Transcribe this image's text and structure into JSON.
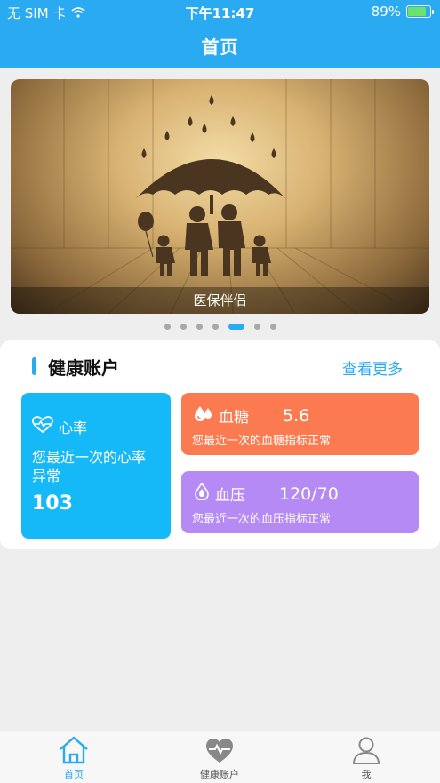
{
  "status_bar": {
    "carrier": "无 SIM 卡",
    "time": "下午11:47",
    "battery": "89%",
    "battery_level": 0.89
  },
  "header": {
    "title": "首页"
  },
  "banner": {
    "caption": "医保伴侣",
    "dot_count": 7,
    "active_index": 4
  },
  "health_section": {
    "title": "健康账户",
    "more_label": "查看更多",
    "heart_rate": {
      "label": "心率",
      "description": "您最近一次的心率异常",
      "value": "103"
    },
    "blood_sugar": {
      "label": "血糖",
      "value": "5.6",
      "description": "您最近一次的血糖指标正常"
    },
    "blood_pressure": {
      "label": "血压",
      "value": "120/70",
      "description": "您最近一次的血压指标正常"
    }
  },
  "tab_bar": {
    "items": [
      {
        "label": "首页",
        "icon": "home-icon",
        "active": true
      },
      {
        "label": "健康账户",
        "icon": "heart-pulse-icon",
        "active": false
      },
      {
        "label": "我",
        "icon": "user-icon",
        "active": false
      }
    ]
  },
  "colors": {
    "primary": "#2aaaf0",
    "heart_tile": "#16b9f7",
    "sugar_tile": "#fc7a50",
    "pressure_tile": "#b68af5"
  }
}
